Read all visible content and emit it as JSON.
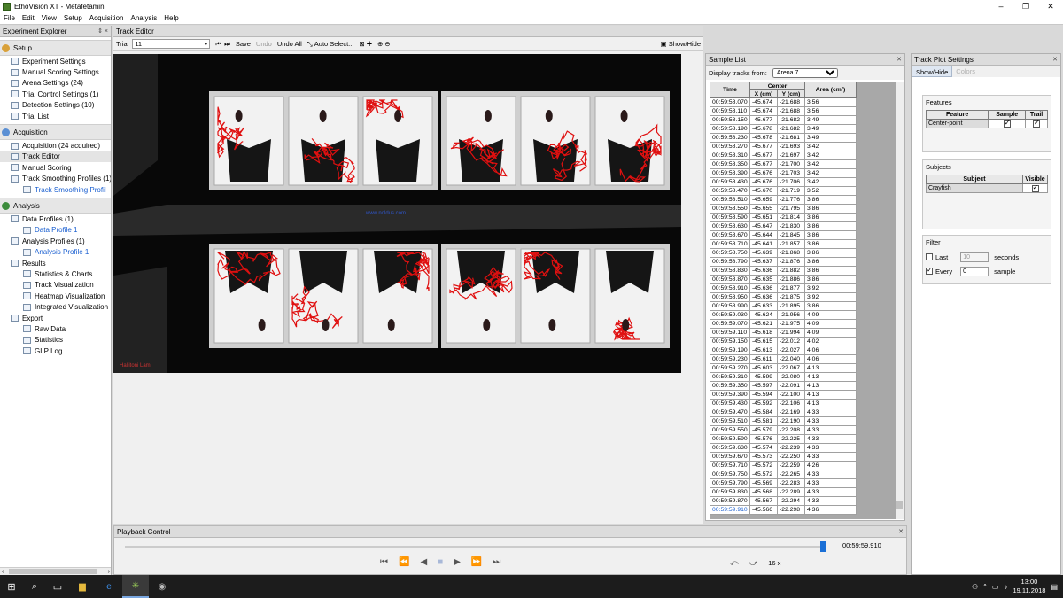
{
  "window": {
    "title": "EthoVision XT - Metafetamin",
    "minimize": "–",
    "maximize": "❐",
    "close": "✕"
  },
  "menu": [
    "File",
    "Edit",
    "View",
    "Setup",
    "Acquisition",
    "Analysis",
    "Help"
  ],
  "explorer": {
    "title": "Experiment Explorer",
    "controls": "⇕ ×",
    "setup_label": "Setup",
    "setup_items": [
      "Experiment Settings",
      "Manual Scoring Settings",
      "Arena Settings (24)",
      "Trial Control Settings (1)",
      "Detection Settings (10)",
      "Trial List"
    ],
    "acquisition_label": "Acquisition",
    "acquisition_items": [
      "Acquisition (24 acquired)",
      "Track Editor",
      "Manual Scoring",
      "Track Smoothing Profiles (1)",
      "Track Smoothing Profil"
    ],
    "analysis_label": "Analysis",
    "analysis_items": [
      "Data Profiles (1)",
      "Data Profile 1",
      "Analysis Profiles (1)",
      "Analysis Profile 1",
      "Results",
      "Statistics & Charts",
      "Track Visualization",
      "Heatmap Visualization",
      "Integrated Visualization",
      "Export",
      "Raw Data",
      "Statistics",
      "GLP Log"
    ],
    "scroll_left": "‹",
    "scroll_right": "›"
  },
  "track_editor": {
    "title": "Track Editor",
    "trial_label": "Trial",
    "trial_value": "11",
    "save": "Save",
    "undo": "Undo",
    "undo_all": "Undo All",
    "auto_select": "Auto Select...",
    "show_hide": "Show/Hide",
    "watermark": "www.noldus.com",
    "cam_label": "Hallitoni Lam"
  },
  "sample_list": {
    "title": "Sample List",
    "display_label": "Display tracks from:",
    "arena": "Arena 7",
    "headers": {
      "time": "Time",
      "center": "Center",
      "x": "X (cm)",
      "y": "Y (cm)",
      "area": "Area (cm²)"
    },
    "rows": [
      [
        "00:59:58.070",
        "-45.674",
        "-21.688",
        "3.56"
      ],
      [
        "00:59:58.110",
        "-45.674",
        "-21.688",
        "3.56"
      ],
      [
        "00:59:58.150",
        "-45.677",
        "-21.682",
        "3.49"
      ],
      [
        "00:59:58.190",
        "-45.678",
        "-21.682",
        "3.49"
      ],
      [
        "00:59:58.230",
        "-45.678",
        "-21.681",
        "3.49"
      ],
      [
        "00:59:58.270",
        "-45.677",
        "-21.693",
        "3.42"
      ],
      [
        "00:59:58.310",
        "-45.677",
        "-21.697",
        "3.42"
      ],
      [
        "00:59:58.350",
        "-45.677",
        "-21.700",
        "3.42"
      ],
      [
        "00:59:58.390",
        "-45.676",
        "-21.703",
        "3.42"
      ],
      [
        "00:59:58.430",
        "-45.676",
        "-21.706",
        "3.42"
      ],
      [
        "00:59:58.470",
        "-45.670",
        "-21.719",
        "3.52"
      ],
      [
        "00:59:58.510",
        "-45.659",
        "-21.776",
        "3.86"
      ],
      [
        "00:59:58.550",
        "-45.655",
        "-21.795",
        "3.86"
      ],
      [
        "00:59:58.590",
        "-45.651",
        "-21.814",
        "3.86"
      ],
      [
        "00:59:58.630",
        "-45.647",
        "-21.830",
        "3.86"
      ],
      [
        "00:59:58.670",
        "-45.644",
        "-21.845",
        "3.86"
      ],
      [
        "00:59:58.710",
        "-45.641",
        "-21.857",
        "3.86"
      ],
      [
        "00:59:58.750",
        "-45.639",
        "-21.868",
        "3.86"
      ],
      [
        "00:59:58.790",
        "-45.637",
        "-21.876",
        "3.86"
      ],
      [
        "00:59:58.830",
        "-45.636",
        "-21.882",
        "3.86"
      ],
      [
        "00:59:58.870",
        "-45.635",
        "-21.886",
        "3.86"
      ],
      [
        "00:59:58.910",
        "-45.636",
        "-21.877",
        "3.92"
      ],
      [
        "00:59:58.950",
        "-45.636",
        "-21.875",
        "3.92"
      ],
      [
        "00:59:58.990",
        "-45.633",
        "-21.895",
        "3.86"
      ],
      [
        "00:59:59.030",
        "-45.624",
        "-21.956",
        "4.09"
      ],
      [
        "00:59:59.070",
        "-45.621",
        "-21.975",
        "4.09"
      ],
      [
        "00:59:59.110",
        "-45.618",
        "-21.994",
        "4.09"
      ],
      [
        "00:59:59.150",
        "-45.615",
        "-22.012",
        "4.02"
      ],
      [
        "00:59:59.190",
        "-45.613",
        "-22.027",
        "4.06"
      ],
      [
        "00:59:59.230",
        "-45.611",
        "-22.040",
        "4.06"
      ],
      [
        "00:59:59.270",
        "-45.603",
        "-22.067",
        "4.13"
      ],
      [
        "00:59:59.310",
        "-45.599",
        "-22.080",
        "4.13"
      ],
      [
        "00:59:59.350",
        "-45.597",
        "-22.091",
        "4.13"
      ],
      [
        "00:59:59.390",
        "-45.594",
        "-22.100",
        "4.13"
      ],
      [
        "00:59:59.430",
        "-45.592",
        "-22.106",
        "4.13"
      ],
      [
        "00:59:59.470",
        "-45.584",
        "-22.169",
        "4.33"
      ],
      [
        "00:59:59.510",
        "-45.581",
        "-22.190",
        "4.33"
      ],
      [
        "00:59:59.550",
        "-45.579",
        "-22.208",
        "4.33"
      ],
      [
        "00:59:59.590",
        "-45.576",
        "-22.225",
        "4.33"
      ],
      [
        "00:59:59.630",
        "-45.574",
        "-22.239",
        "4.33"
      ],
      [
        "00:59:59.670",
        "-45.573",
        "-22.250",
        "4.33"
      ],
      [
        "00:59:59.710",
        "-45.572",
        "-22.259",
        "4.26"
      ],
      [
        "00:59:59.750",
        "-45.572",
        "-22.265",
        "4.33"
      ],
      [
        "00:59:59.790",
        "-45.569",
        "-22.283",
        "4.33"
      ],
      [
        "00:59:59.830",
        "-45.568",
        "-22.289",
        "4.33"
      ],
      [
        "00:59:59.870",
        "-45.567",
        "-22.294",
        "4.33"
      ],
      [
        "00:59:59.910",
        "-45.566",
        "-22.298",
        "4.36"
      ]
    ]
  },
  "track_plot": {
    "title": "Track Plot Settings",
    "tab_active": "Show/Hide",
    "tab_inactive": "Colors",
    "features_label": "Features",
    "features_headers": [
      "Feature",
      "Sample",
      "Trail"
    ],
    "feature_row": "Center-point",
    "subjects_label": "Subjects",
    "subjects_headers": [
      "Subject",
      "Visible"
    ],
    "subject_row": "Crayfish",
    "filter_label": "Filter",
    "last_label": "Last",
    "last_value": "10",
    "last_unit": "seconds",
    "every_label": "Every",
    "every_value": "0",
    "every_unit": "sample"
  },
  "playback": {
    "title": "Playback Control",
    "time": "00:59:59.910",
    "speed": "16 x",
    "position": 0.997
  },
  "taskbar": {
    "time": "13:00",
    "date": "19.11.2018"
  }
}
